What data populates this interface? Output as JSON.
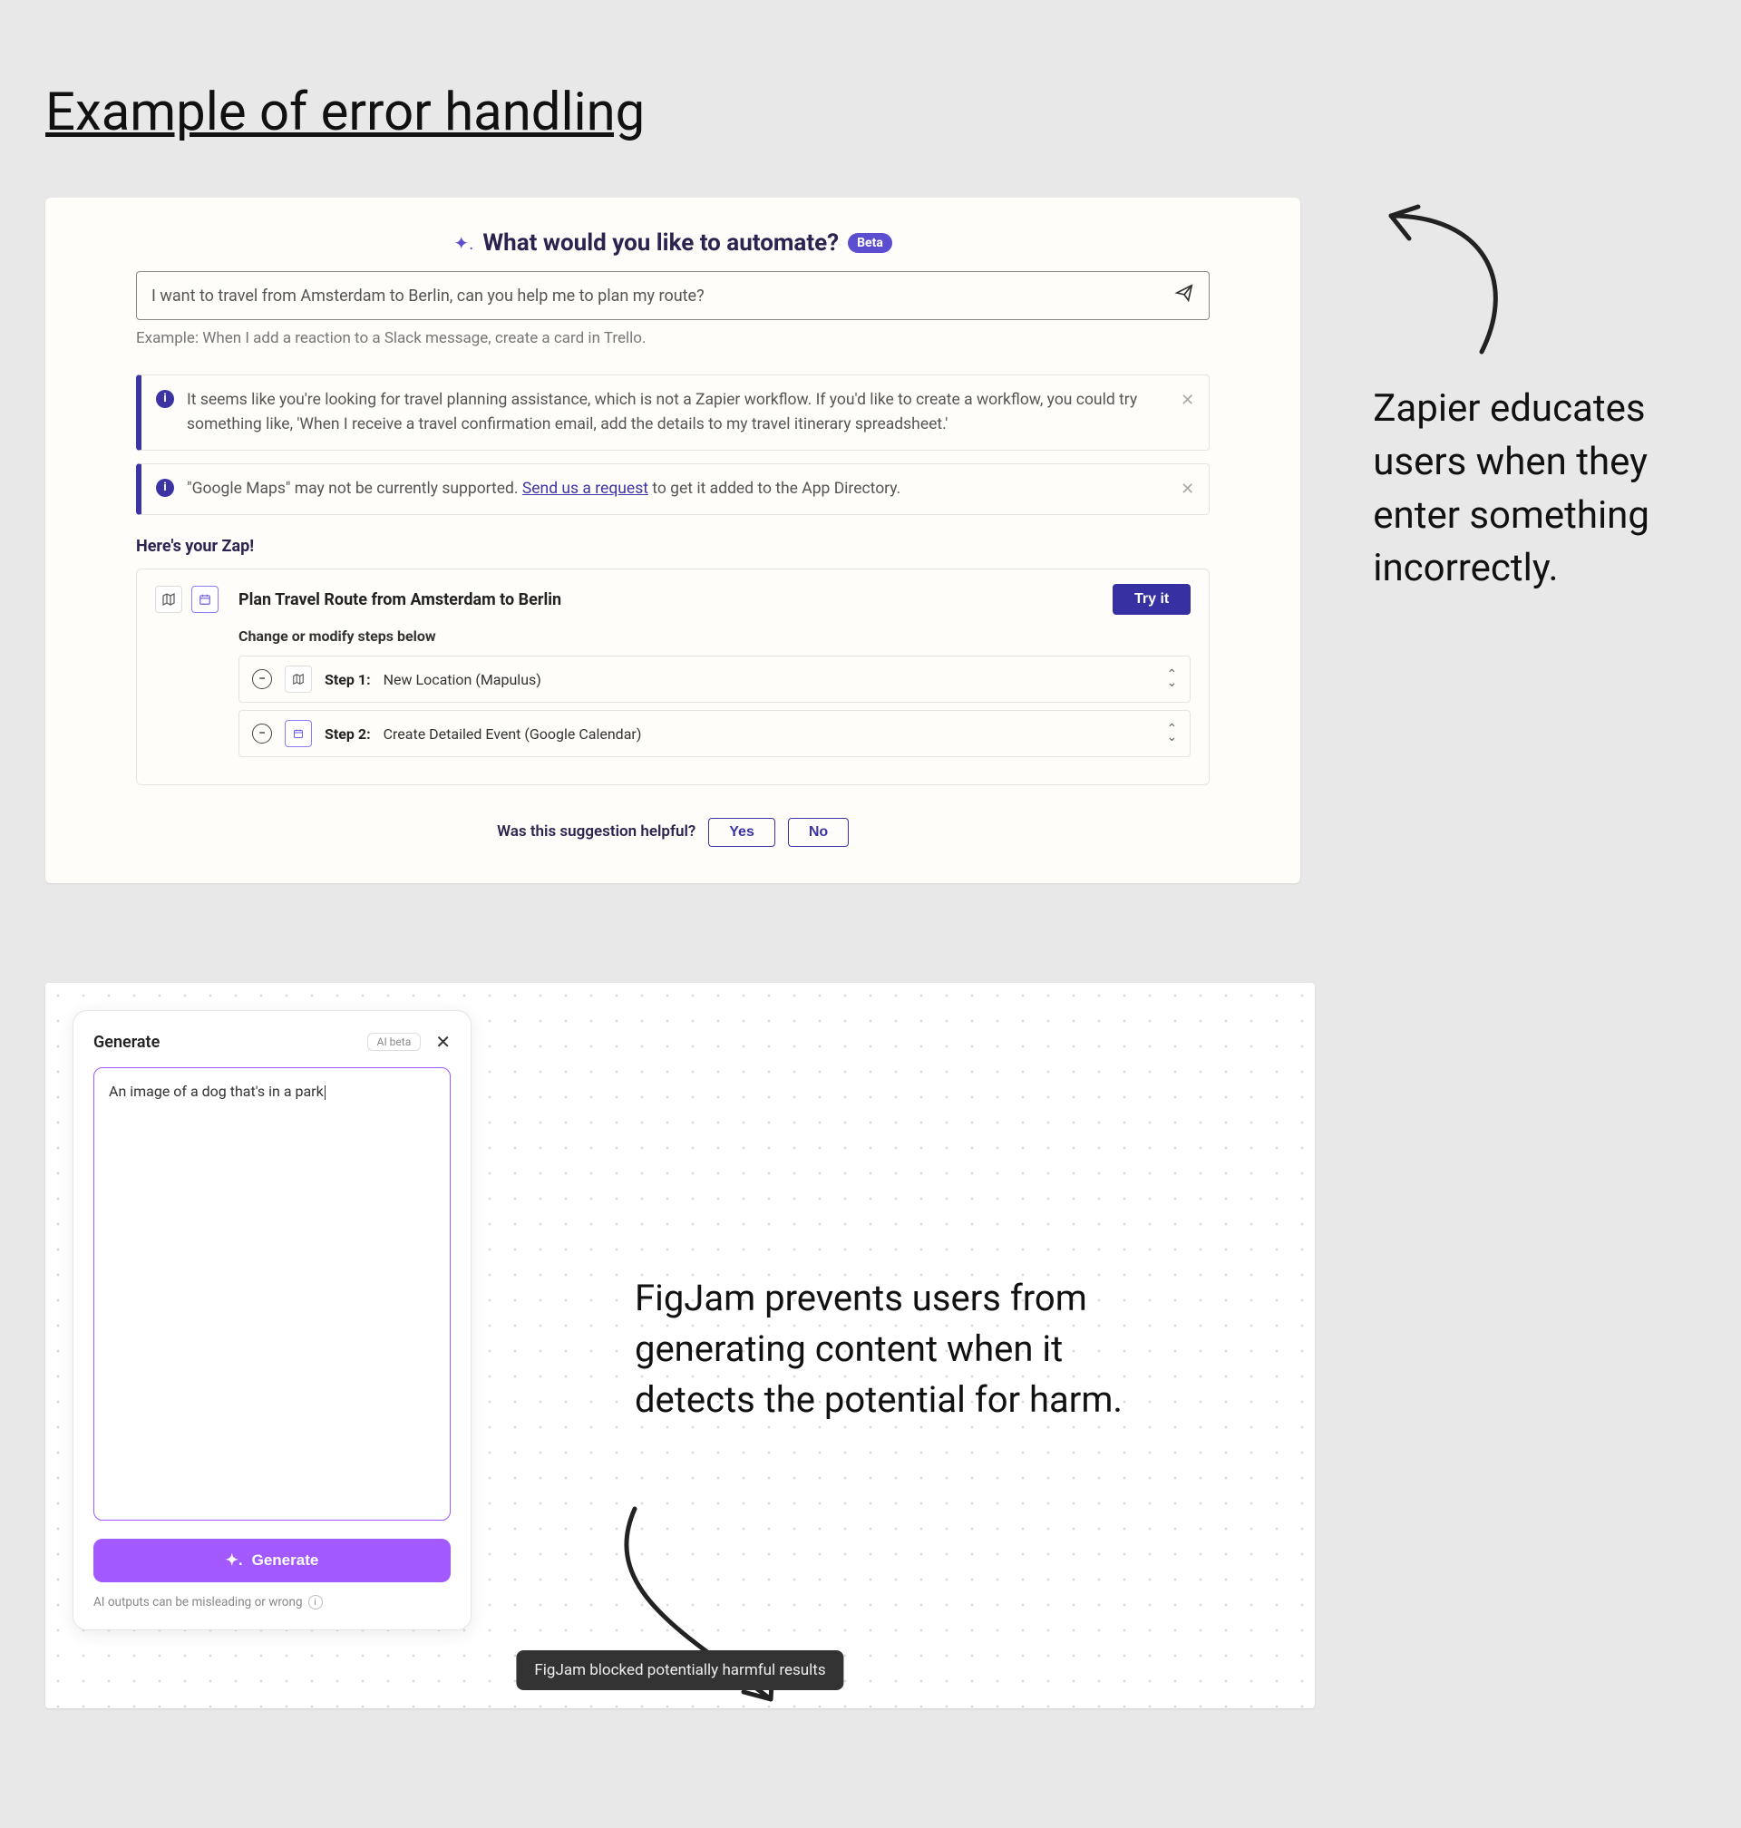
{
  "page_title": "Example of error handling",
  "zapier": {
    "head": {
      "title": "What would you like to automate?",
      "badge": "Beta"
    },
    "input_text": "I want to travel from Amsterdam to Berlin, can you help me to plan my route?",
    "example_text": "Example: When I add a reaction to a Slack message, create a card in Trello.",
    "info1": "It seems like you're looking for travel planning assistance, which is not a Zapier workflow. If you'd like to create a workflow, you could try something like, 'When I receive a travel confirmation email, add the details to my travel itinerary spreadsheet.'",
    "info2_pre": "\"Google Maps\" may not be currently supported. ",
    "info2_link": "Send us a request",
    "info2_post": " to get it added to the App Directory.",
    "section": "Here's your Zap!",
    "zap_title": "Plan Travel Route from Amsterdam to Berlin",
    "try_it": "Try it",
    "modify": "Change or modify steps below",
    "step1_label": "Step 1:",
    "step1_name": "New Location (Mapulus)",
    "step2_label": "Step 2:",
    "step2_name": "Create Detailed Event (Google Calendar)",
    "feedback_q": "Was this suggestion helpful?",
    "yes": "Yes",
    "no": "No"
  },
  "zapier_annotation": "Zapier educates users when they enter something incorrectly.",
  "figjam": {
    "panel_title": "Generate",
    "ai_beta": "AI beta",
    "textarea": "An image of a dog that's in a park",
    "generate": "Generate",
    "disclaimer": "AI outputs can be misleading or wrong",
    "toast": "FigJam blocked potentially harmful results"
  },
  "figjam_annotation": "FigJam prevents users from generating content when it detects the potential for harm."
}
